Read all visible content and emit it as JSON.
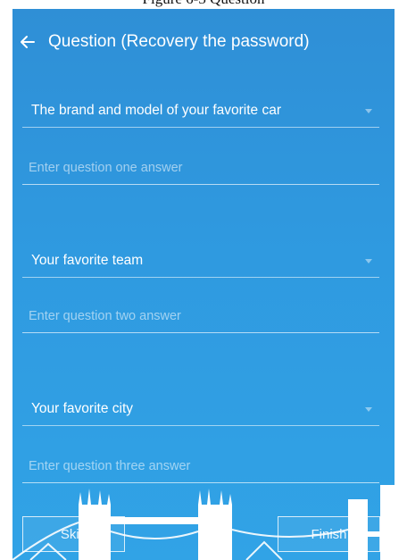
{
  "caption": "Figure 6-3 Question",
  "header": {
    "title": "Question (Recovery the password)"
  },
  "questions": [
    {
      "label": "The brand and model of your favorite car",
      "placeholder": "Enter question one answer"
    },
    {
      "label": "Your favorite team",
      "placeholder": "Enter question two answer"
    },
    {
      "label": "Your favorite city",
      "placeholder": "Enter question three answer"
    }
  ],
  "footer": {
    "skip_label": "Skip",
    "finish_label": "Finish"
  },
  "colors": {
    "background": "#2f9ae0",
    "text": "#ffffff"
  }
}
